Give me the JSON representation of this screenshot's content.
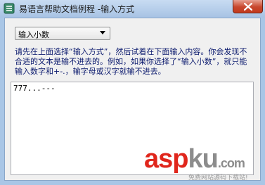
{
  "window": {
    "title": "易语言帮助文档例程 -输入方式",
    "app_icon": "document-icon",
    "close_icon": "close-icon"
  },
  "combo": {
    "selected": "输入小数"
  },
  "instructions": {
    "text": "请先在上面选择“输入方式”，然后试着在下面输入内容。你会发现不合适的文本是输不进去的。例如，如果你选择了“输入小数”，就只能输入数字和+-.，输字母或汉字就输不进去。"
  },
  "textbox": {
    "value": "777...---"
  },
  "watermark": {
    "brand_red": "asp",
    "brand_gray": "ku",
    "brand_suffix": ".com",
    "subtitle": "免费网站源码下载站!"
  },
  "colors": {
    "title_bar": "#b9d1ea",
    "close_button": "#c8472d",
    "instruction_text": "#0b1a6e",
    "watermark_red": "#e0261c",
    "watermark_gray": "#8c8c8c"
  }
}
